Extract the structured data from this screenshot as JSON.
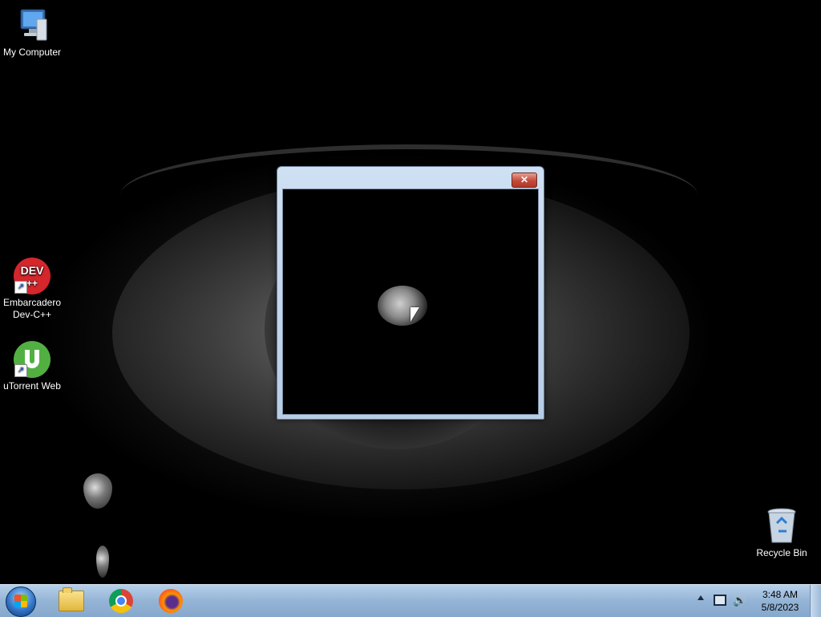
{
  "desktop": {
    "icons": [
      {
        "label": "My Computer",
        "icon": "computer-icon"
      },
      {
        "label_line1": "Embarcadero",
        "label_line2": "Dev-C++",
        "icon": "devcpp-icon",
        "badge_text": "DEV"
      },
      {
        "label": "uTorrent Web",
        "icon": "utorrent-icon"
      },
      {
        "label": "Recycle Bin",
        "icon": "recycle-bin-icon"
      }
    ]
  },
  "window": {
    "close_glyph": "✕"
  },
  "taskbar": {
    "items": [
      "start-button",
      "file-explorer",
      "google-chrome",
      "firefox"
    ],
    "tray": {
      "time": "3:48 AM",
      "date": "5/8/2023",
      "volume_glyph": "🔊"
    }
  },
  "colors": {
    "taskbar": "#94b4d6",
    "window_frame": "#c4d7ee",
    "close_button": "#c24a3a"
  }
}
